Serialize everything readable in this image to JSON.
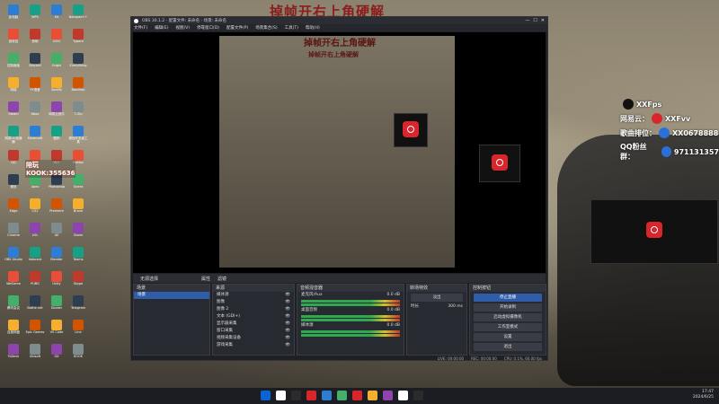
{
  "banner": "掉帧开右上角硬解",
  "obs": {
    "title": "OBS 30.1.2 - 配置文件: 未命名 - 场景: 未命名",
    "menu": [
      "文件(F)",
      "编辑(E)",
      "视图(V)",
      "停靠窗口(D)",
      "配置文件(P)",
      "场景集合(S)",
      "工具(T)",
      "帮助(H)"
    ],
    "preview_banner": "掉帧开右上角硬解",
    "preview_sub": "掉帧开右上角硬解",
    "scene_tabs": [
      "无源选择",
      "属性",
      "滤镜"
    ],
    "docks": {
      "scenes": {
        "title": "场景",
        "items": [
          "场景"
        ]
      },
      "sources": {
        "title": "来源",
        "items": [
          "媒体源",
          "图像",
          "图像 2",
          "文本 (GDI+)",
          "显示器采集",
          "窗口采集",
          "视频采集设备",
          "游戏采集"
        ]
      },
      "mixer": {
        "title": "音频混音器",
        "items": [
          {
            "name": "麦克风/Aux",
            "val": "0.0 dB"
          },
          {
            "name": "桌面音频",
            "val": "0.0 dB"
          },
          {
            "name": "媒体源",
            "val": "0.0 dB"
          }
        ]
      },
      "transitions": {
        "title": "转场特效",
        "type": "淡出",
        "duration_label": "时长",
        "duration": "300 ms"
      },
      "controls": {
        "title": "控制按钮",
        "buttons": [
          "停止直播",
          "开始录制",
          "启动虚拟摄像机",
          "工作室模式",
          "设置",
          "退出"
        ]
      }
    },
    "status": [
      "LIVE: 00:00:00",
      "REC: 00:00:00",
      "CPU: 0.1%, 60.00 fps"
    ]
  },
  "overlay": {
    "rows": [
      {
        "label": "",
        "value": "XXFps",
        "color": "#111"
      },
      {
        "label": "网易云：",
        "value": "XXFvv",
        "color": "#d9262c"
      },
      {
        "label": "歌曲排位：",
        "value": "XX0678888",
        "color": "#2a70d6"
      },
      {
        "label": "QQ粉丝群：",
        "value": "971131357",
        "color": "#2a70d6"
      }
    ]
  },
  "desktop": {
    "sticker_name": "KOOK:355636",
    "sticker_sub": "陪玩",
    "icons": [
      "此电脑",
      "回收站",
      "控制面板",
      "网络",
      "Steam",
      "网易UU加速器",
      "QQ",
      "微信",
      "Edge",
      "Chrome",
      "OBS Studio",
      "WeGame",
      "腾讯会议",
      "百度网盘",
      "ToDesk",
      "WPS",
      "剪映",
      "Discord",
      "YY语音",
      "Xbox",
      "Minecraft",
      "原神",
      "Apex",
      "CS2",
      "LOL",
      "Valorant",
      "PUBG",
      "Battle.net",
      "Epic Games",
      "Ubisoft",
      "EA",
      "GOG",
      "Origin",
      "Spotify",
      "网易云音乐",
      "酷狗",
      "VLC",
      "Photoshop",
      "Premiere",
      "AE",
      "Blender",
      "Unity",
      "Docker",
      "VS Code",
      "Git",
      "Notepad++",
      "Typora",
      "Everything",
      "Bandizip",
      "7-Zip",
      "微信开发者工具",
      "Firefox",
      "Opera",
      "Brave",
      "Zoom",
      "Teams",
      "Skype",
      "Telegram",
      "Line",
      "KOOK"
    ]
  },
  "taskbar": {
    "time": "17:47",
    "date": "2024/6/25"
  },
  "colors": {
    "accent": "#2f5da9",
    "banner": "#8b1c1c",
    "record": "#d9262c"
  }
}
